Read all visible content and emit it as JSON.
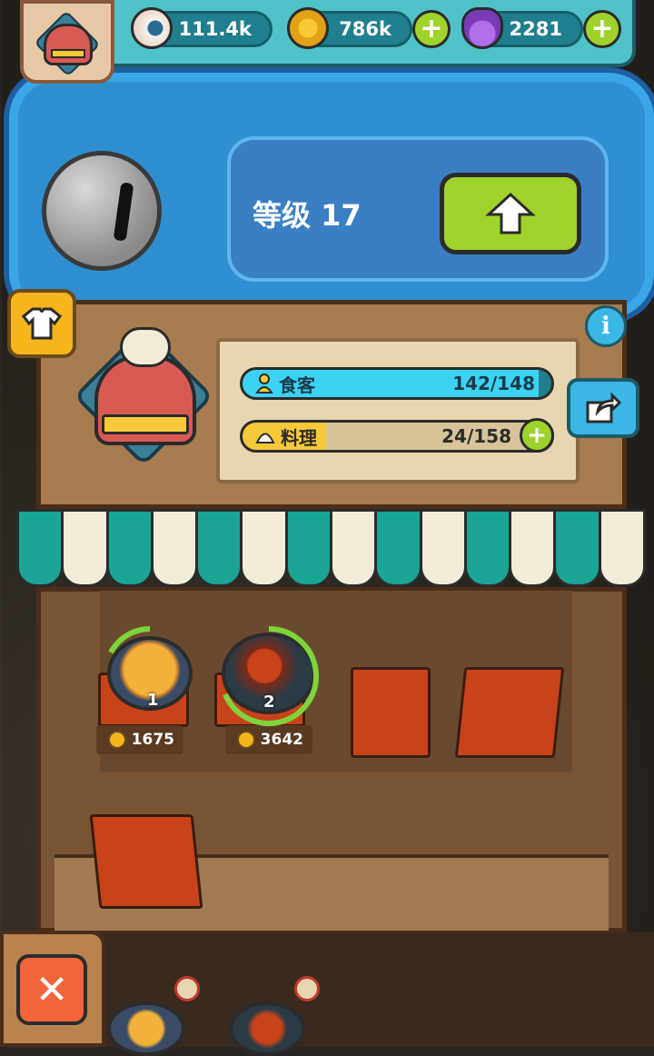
{
  "resources": {
    "eyes": "111.4k",
    "coins": "786k",
    "potions": "2281"
  },
  "level": {
    "label": "等级 17"
  },
  "stats": {
    "customers": {
      "label": "食客",
      "value": "142/148",
      "fraction": 0.959
    },
    "dishes": {
      "label": "料理",
      "value": "24/158",
      "fraction": 0.152
    }
  },
  "stall": {
    "slots": [
      {
        "number": "1",
        "price": "1675"
      },
      {
        "number": "2",
        "price": "3642"
      }
    ]
  },
  "buttons": {
    "close_glyph": "✕",
    "info_glyph": "i",
    "plus_glyph": "+"
  },
  "colors": {
    "accent_green": "#9fd22b",
    "bar_blue": "#3cd2f2",
    "bar_yellow": "#f6c93a",
    "awning_teal": "#1aa594",
    "awning_cream": "#f3ecd8"
  },
  "icons": [
    "eyeball-icon",
    "coin-icon",
    "potion-icon",
    "plus-icon",
    "arrow-up-icon",
    "shirt-icon",
    "info-icon",
    "share-icon",
    "person-icon",
    "dumpling-icon",
    "close-icon",
    "no-entry-icon"
  ]
}
